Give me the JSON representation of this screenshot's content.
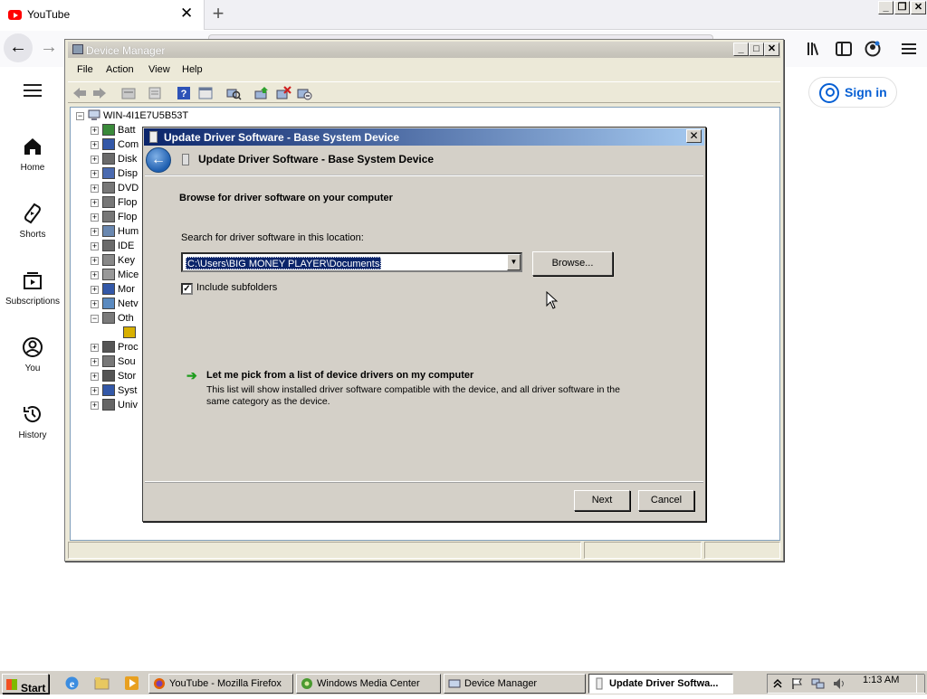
{
  "browser": {
    "tab_title": "YouTube",
    "tab_close": "✕",
    "new_tab": "+",
    "back_icon": "←",
    "forward_icon": "→",
    "tools": [
      "library-icon",
      "sidebar-icon",
      "account-icon",
      "menu-icon"
    ]
  },
  "youtube": {
    "nav": [
      {
        "label": "Home",
        "icon": "home-icon"
      },
      {
        "label": "Shorts",
        "icon": "shorts-icon"
      },
      {
        "label": "Subscriptions",
        "icon": "subscriptions-icon"
      },
      {
        "label": "You",
        "icon": "you-icon"
      },
      {
        "label": "History",
        "icon": "history-icon"
      }
    ],
    "sign_in": "Sign in"
  },
  "device_manager": {
    "title": "Device Manager",
    "menu": [
      "File",
      "Action",
      "View",
      "Help"
    ],
    "tree_root": "WIN-4I1E7U5B53T",
    "tree_items": [
      {
        "label": "Batt",
        "expander": "+"
      },
      {
        "label": "Com",
        "expander": "+"
      },
      {
        "label": "Disk",
        "expander": "+"
      },
      {
        "label": "Disp",
        "expander": "+"
      },
      {
        "label": "DVD",
        "expander": "+"
      },
      {
        "label": "Flop",
        "expander": "+"
      },
      {
        "label": "Flop",
        "expander": "+"
      },
      {
        "label": "Hum",
        "expander": "+"
      },
      {
        "label": "IDE",
        "expander": "+"
      },
      {
        "label": "Key",
        "expander": "+"
      },
      {
        "label": "Mice",
        "expander": "+"
      },
      {
        "label": "Mor",
        "expander": "+"
      },
      {
        "label": "Netv",
        "expander": "+"
      },
      {
        "label": "Oth",
        "expander": "−"
      },
      {
        "label": "",
        "expander": ""
      },
      {
        "label": "Proc",
        "expander": "+"
      },
      {
        "label": "Sou",
        "expander": "+"
      },
      {
        "label": "Stor",
        "expander": "+"
      },
      {
        "label": "Syst",
        "expander": "+"
      },
      {
        "label": "Univ",
        "expander": "+"
      }
    ]
  },
  "update_driver": {
    "window_title": "Update Driver Software - Base System Device",
    "header": "Update Driver Software - Base System Device",
    "heading": "Browse for driver software on your computer",
    "search_label": "Search for driver software in this location:",
    "path_value": "C:\\Users\\BIG MONEY PLAYER\\Documents",
    "browse_label": "Browse...",
    "include_subfolders": "Include subfolders",
    "include_subfolders_checked": true,
    "pick_title": "Let me pick from a list of device drivers on my computer",
    "pick_desc": "This list will show installed driver software compatible with the device, and all driver software in the same category as the device.",
    "next_label": "Next",
    "cancel_label": "Cancel",
    "close_icon": "✕"
  },
  "taskbar": {
    "start": "Start",
    "tasks": [
      {
        "label": "YouTube - Mozilla Firefox"
      },
      {
        "label": "Windows Media Center"
      },
      {
        "label": "Device Manager"
      },
      {
        "label": "Update Driver Softwa..."
      }
    ],
    "clock": "1:13 AM"
  },
  "colors": {
    "dialog_title_start": "#0a246a",
    "dialog_title_end": "#a6caf0",
    "youtube_red": "#ff0000",
    "signin_blue": "#065fd4"
  }
}
